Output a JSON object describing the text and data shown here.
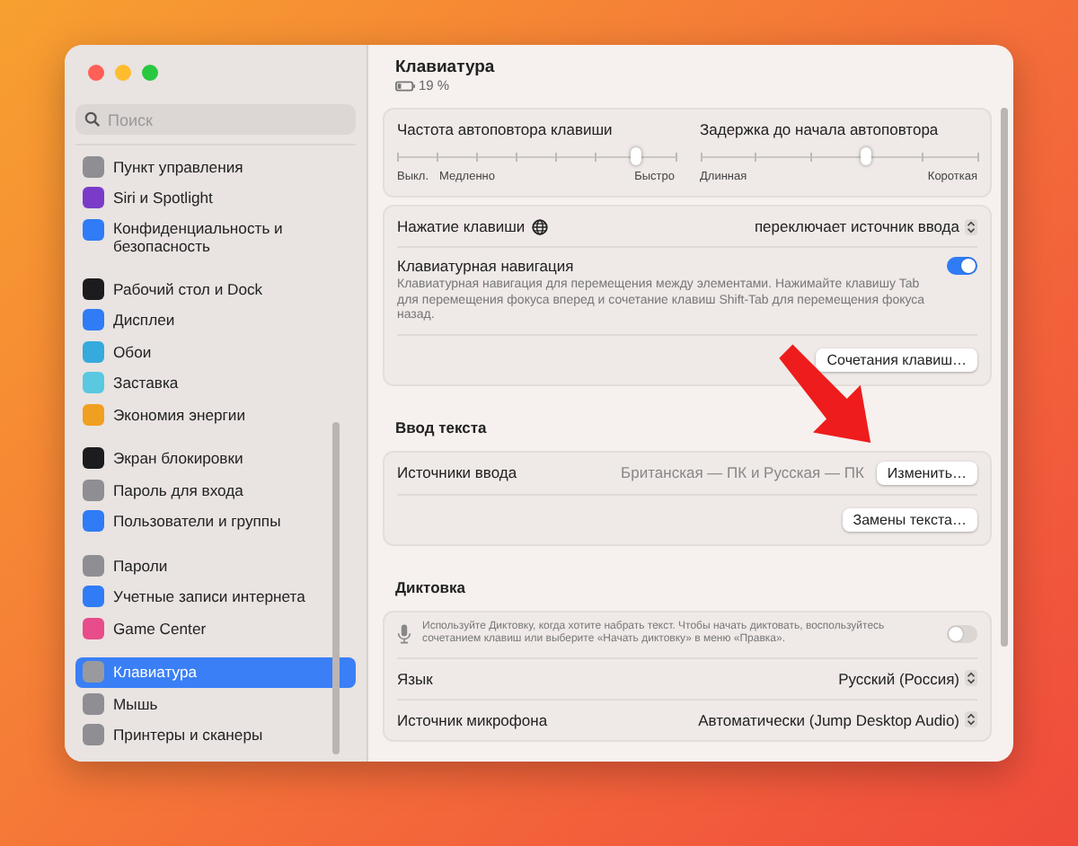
{
  "sidebar": {
    "search": {
      "placeholder": "Поиск"
    },
    "groups": [
      [
        {
          "label": "Пункт управления",
          "selected": false,
          "color": "#8e8e93"
        },
        {
          "label": "Siri и Spotlight",
          "selected": false,
          "color": "#7a3cc8"
        },
        {
          "label": "Конфиденциальность и безопасность",
          "selected": false,
          "color": "#2f7cf6"
        }
      ],
      [
        {
          "label": "Рабочий стол и Dock",
          "selected": false,
          "color": "#1c1c1e"
        },
        {
          "label": "Дисплеи",
          "selected": false,
          "color": "#2f7cf6"
        },
        {
          "label": "Обои",
          "selected": false,
          "color": "#35aadc"
        },
        {
          "label": "Заставка",
          "selected": false,
          "color": "#5ac8e0"
        },
        {
          "label": "Экономия энергии",
          "selected": false,
          "color": "#f0a020"
        }
      ],
      [
        {
          "label": "Экран блокировки",
          "selected": false,
          "color": "#1c1c1e"
        },
        {
          "label": "Пароль для входа",
          "selected": false,
          "color": "#8e8e93"
        },
        {
          "label": "Пользователи и группы",
          "selected": false,
          "color": "#2f7cf6"
        }
      ],
      [
        {
          "label": "Пароли",
          "selected": false,
          "color": "#8e8e93"
        },
        {
          "label": "Учетные записи интернета",
          "selected": false,
          "color": "#2f7cf6"
        },
        {
          "label": "Game Center",
          "selected": false,
          "color": "#e84c8a"
        }
      ],
      [
        {
          "label": "Клавиатура",
          "selected": true,
          "color": "#9a9a9e"
        },
        {
          "label": "Мышь",
          "selected": false,
          "color": "#8e8e93"
        },
        {
          "label": "Принтеры и сканеры",
          "selected": false,
          "color": "#8e8e93"
        }
      ]
    ]
  },
  "content": {
    "title": "Клавиатура",
    "battery": "19 %",
    "panels": [
      {
        "rows": [
          {
            "kind": "sliders",
            "sliders": [
              {
                "label": "Частота автоповтора клавиши",
                "level": 0.86,
                "left_labels": [
                  "Выкл.",
                  "Медленно"
                ],
                "right_label": "Быстро"
              },
              {
                "label": "Задержка до начала автоповтора",
                "level": 0.6,
                "left_labels": [
                  "Длинная"
                ],
                "right_label": "Короткая"
              }
            ]
          }
        ]
      },
      {
        "rows": [
          {
            "kind": "key-popup",
            "label": "Нажатие клавиши",
            "value": "переключает источник ввода"
          },
          {
            "kind": "toggle",
            "label": "Клавиатурная навигация",
            "description": "Клавиатурная навигация для перемещения между элементами. Нажимайте клавишу Tab для перемещения фокуса вперед и сочетание клавиш Shift-Tab для перемещения фокуса назад.",
            "on": true
          },
          {
            "kind": "buttons",
            "buttons": [
              "Сочетания клавиш…"
            ]
          }
        ]
      },
      {
        "heading": "Ввод текста",
        "rows": [
          {
            "kind": "value-button",
            "label": "Источники ввода",
            "value": "Британская — ПК и Русская — ПК",
            "button": "Изменить…"
          },
          {
            "kind": "buttons",
            "buttons": [
              "Замены текста…"
            ]
          }
        ]
      },
      {
        "heading": "Диктовка",
        "rows": [
          {
            "kind": "mic-toggle",
            "description": "Используйте Диктовку, когда хотите набрать текст. Чтобы начать диктовать, воспользуйтесь сочетанием клавиш или выберите «Начать диктовку» в меню «Правка».",
            "on": false
          },
          {
            "kind": "popup",
            "label": "Язык",
            "value": "Русский (Россия)"
          },
          {
            "kind": "popup",
            "label": "Источник микрофона",
            "value": "Автоматически (Jump Desktop Audio)"
          }
        ]
      }
    ]
  }
}
